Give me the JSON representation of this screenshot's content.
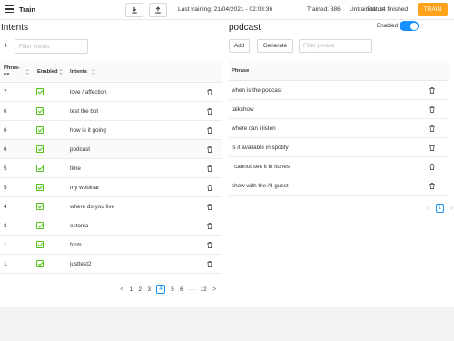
{
  "header": {
    "title": "Train",
    "last_training": "Last training: 21/04/2021 - 02:03:36",
    "trained": "Trained: 386",
    "untrained": "Untrained: 14",
    "status": "Status: finished",
    "train_button": "TRAIN"
  },
  "intents_panel": {
    "title": "Intents",
    "add": "+",
    "filter_placeholder": "Filter intents",
    "columns": [
      "Phras-\nes",
      "Enabled",
      "Intents"
    ],
    "rows": [
      {
        "phrases": "7",
        "intent": "love / affection"
      },
      {
        "phrases": "6",
        "intent": "test the bot"
      },
      {
        "phrases": "6",
        "intent": "how is it going"
      },
      {
        "phrases": "6",
        "intent": "podcast"
      },
      {
        "phrases": "5",
        "intent": "time"
      },
      {
        "phrases": "5",
        "intent": "my webinar"
      },
      {
        "phrases": "4",
        "intent": "where do you live"
      },
      {
        "phrases": "3",
        "intent": "estonia"
      },
      {
        "phrases": "1",
        "intent": "form"
      },
      {
        "phrases": "1",
        "intent": "justtest2"
      }
    ],
    "pagination": {
      "prev": "<",
      "pages": [
        "1",
        "2",
        "3",
        "4",
        "5",
        "6",
        "···",
        "12"
      ],
      "current": "4",
      "next": ">"
    }
  },
  "phrases_panel": {
    "title": "podcast",
    "enabled_label": "Enabled",
    "enabled": true,
    "add_button": "Add",
    "generate_button": "Generate",
    "filter_placeholder": "Filter phrase",
    "column": "Phrase",
    "rows": [
      "when is the podcast",
      "talkshow",
      "where can i listen",
      "is it available in spotify",
      "i cannot see it in itunes",
      "show with the AI guest"
    ],
    "pagination": {
      "prev": "<",
      "current": "1",
      "next": ">"
    }
  },
  "colors": {
    "accent": "#1890ff",
    "train": "#ffa31a",
    "check": "#52c41a"
  }
}
